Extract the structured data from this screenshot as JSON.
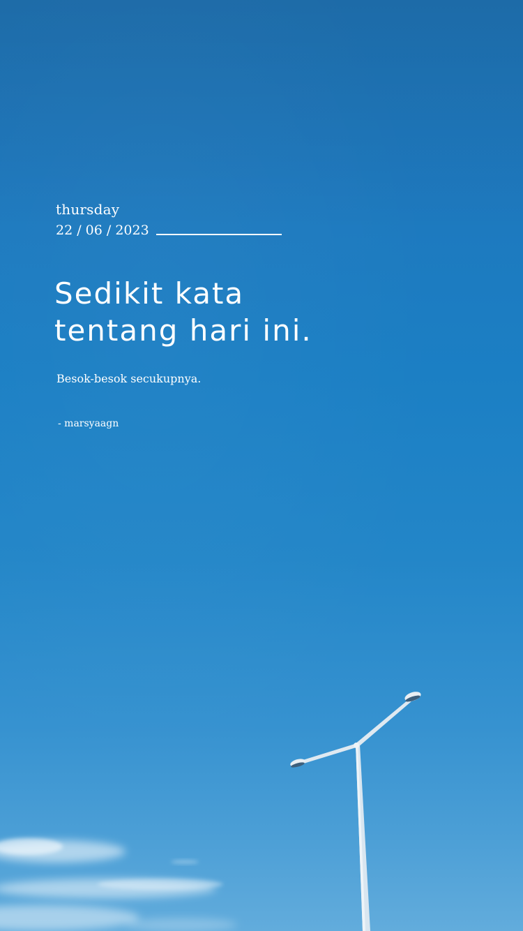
{
  "day": "thursday",
  "date": "22 / 06 / 2023",
  "headline": {
    "line1": "Sedikit kata",
    "line2": "tentang hari ini."
  },
  "subtitle": "Besok-besok secukupnya.",
  "author": "- marsyaagn",
  "colors": {
    "sky_top": "#1f74b6",
    "sky_bottom": "#62acdc",
    "text": "#ffffff"
  }
}
